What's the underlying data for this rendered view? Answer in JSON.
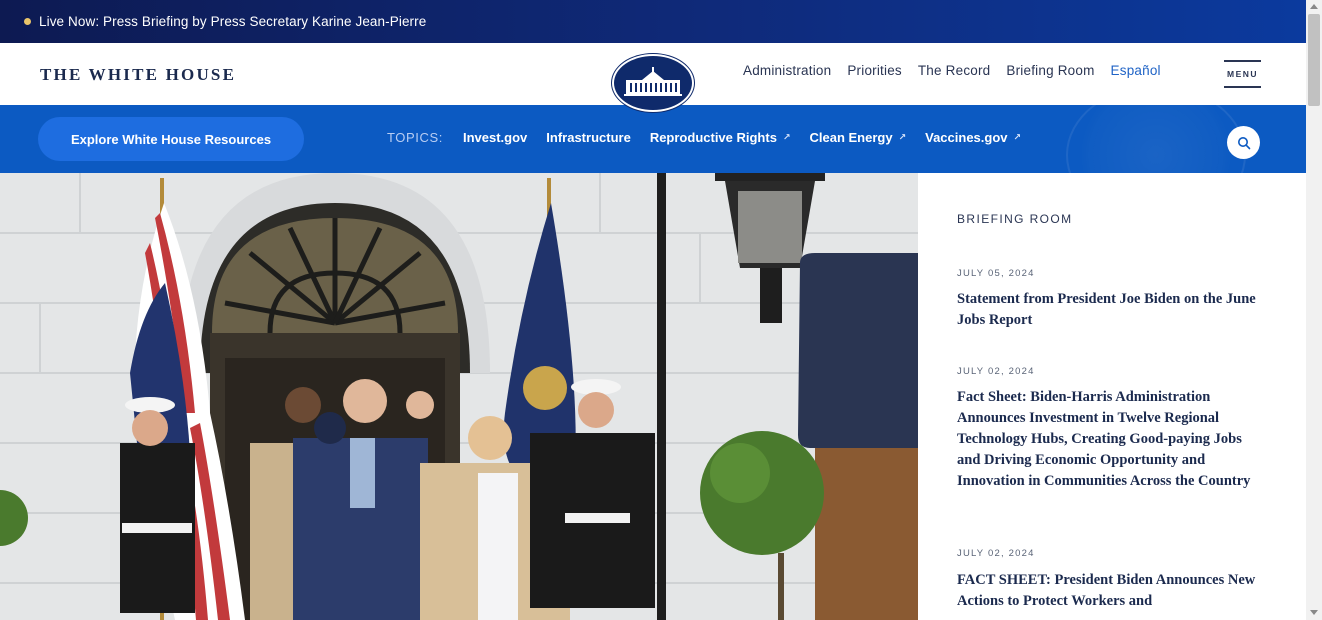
{
  "live_banner": {
    "text": "Live Now: Press Briefing by Press Secretary Karine Jean-Pierre"
  },
  "header": {
    "site_title": "THE WHITE HOUSE",
    "nav": [
      {
        "label": "Administration"
      },
      {
        "label": "Priorities"
      },
      {
        "label": "The Record"
      },
      {
        "label": "Briefing Room"
      },
      {
        "label": "Español"
      }
    ],
    "menu_label": "MENU"
  },
  "topics_bar": {
    "explore_label": "Explore White House Resources",
    "topics_label": "TOPICS:",
    "topics": [
      {
        "label": "Invest.gov",
        "external": false
      },
      {
        "label": "Infrastructure",
        "external": false
      },
      {
        "label": "Reproductive Rights",
        "external": true
      },
      {
        "label": "Clean Energy",
        "external": true
      },
      {
        "label": "Vaccines.gov",
        "external": true
      }
    ],
    "external_glyph": "↗",
    "accent": "#0c5ac2"
  },
  "briefing_room": {
    "heading": "BRIEFING ROOM",
    "items": [
      {
        "date": "JULY 05, 2024",
        "title": "Statement from President Joe Biden on the June Jobs Report"
      },
      {
        "date": "JULY 02, 2024",
        "title": "Fact Sheet: Biden-Harris Administration Announces Investment in Twelve Regional Technology Hubs, Creating Good-paying Jobs and Driving Economic Opportunity and Innovation in Communities Across the Country"
      },
      {
        "date": "JULY 02, 2024",
        "title": "FACT SHEET: President Biden Announces New Actions to Protect Workers and"
      }
    ]
  },
  "icons": {
    "search": "search-icon",
    "menu": "hamburger-menu-icon",
    "seal": "white-house-seal-icon"
  }
}
